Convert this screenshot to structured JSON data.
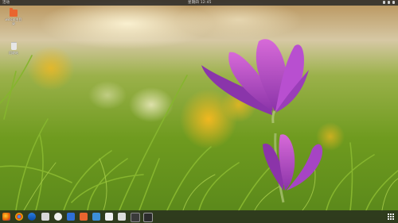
{
  "topbar": {
    "left_text": "活动",
    "clock": "星期四 12:45"
  },
  "desktop_icons": [
    {
      "label": "wincin主目录",
      "icon": "home-folder-icon"
    },
    {
      "label": "回收站",
      "icon": "trash-icon"
    }
  ],
  "dock": {
    "apps": [
      "firefox-icon",
      "chrome-icon",
      "thunderbird-icon",
      "files-icon",
      "settings-icon",
      "document-icon",
      "presentation-icon",
      "software-icon",
      "help-icon",
      "amazon-icon",
      "system-monitor-icon",
      "terminal-icon"
    ],
    "show_apps_icon": "apps-grid-icon"
  },
  "colors": {
    "accent_orange": "#e9652f",
    "topbar_bg": "#282828",
    "dock_bg": "#1e1e1e"
  }
}
